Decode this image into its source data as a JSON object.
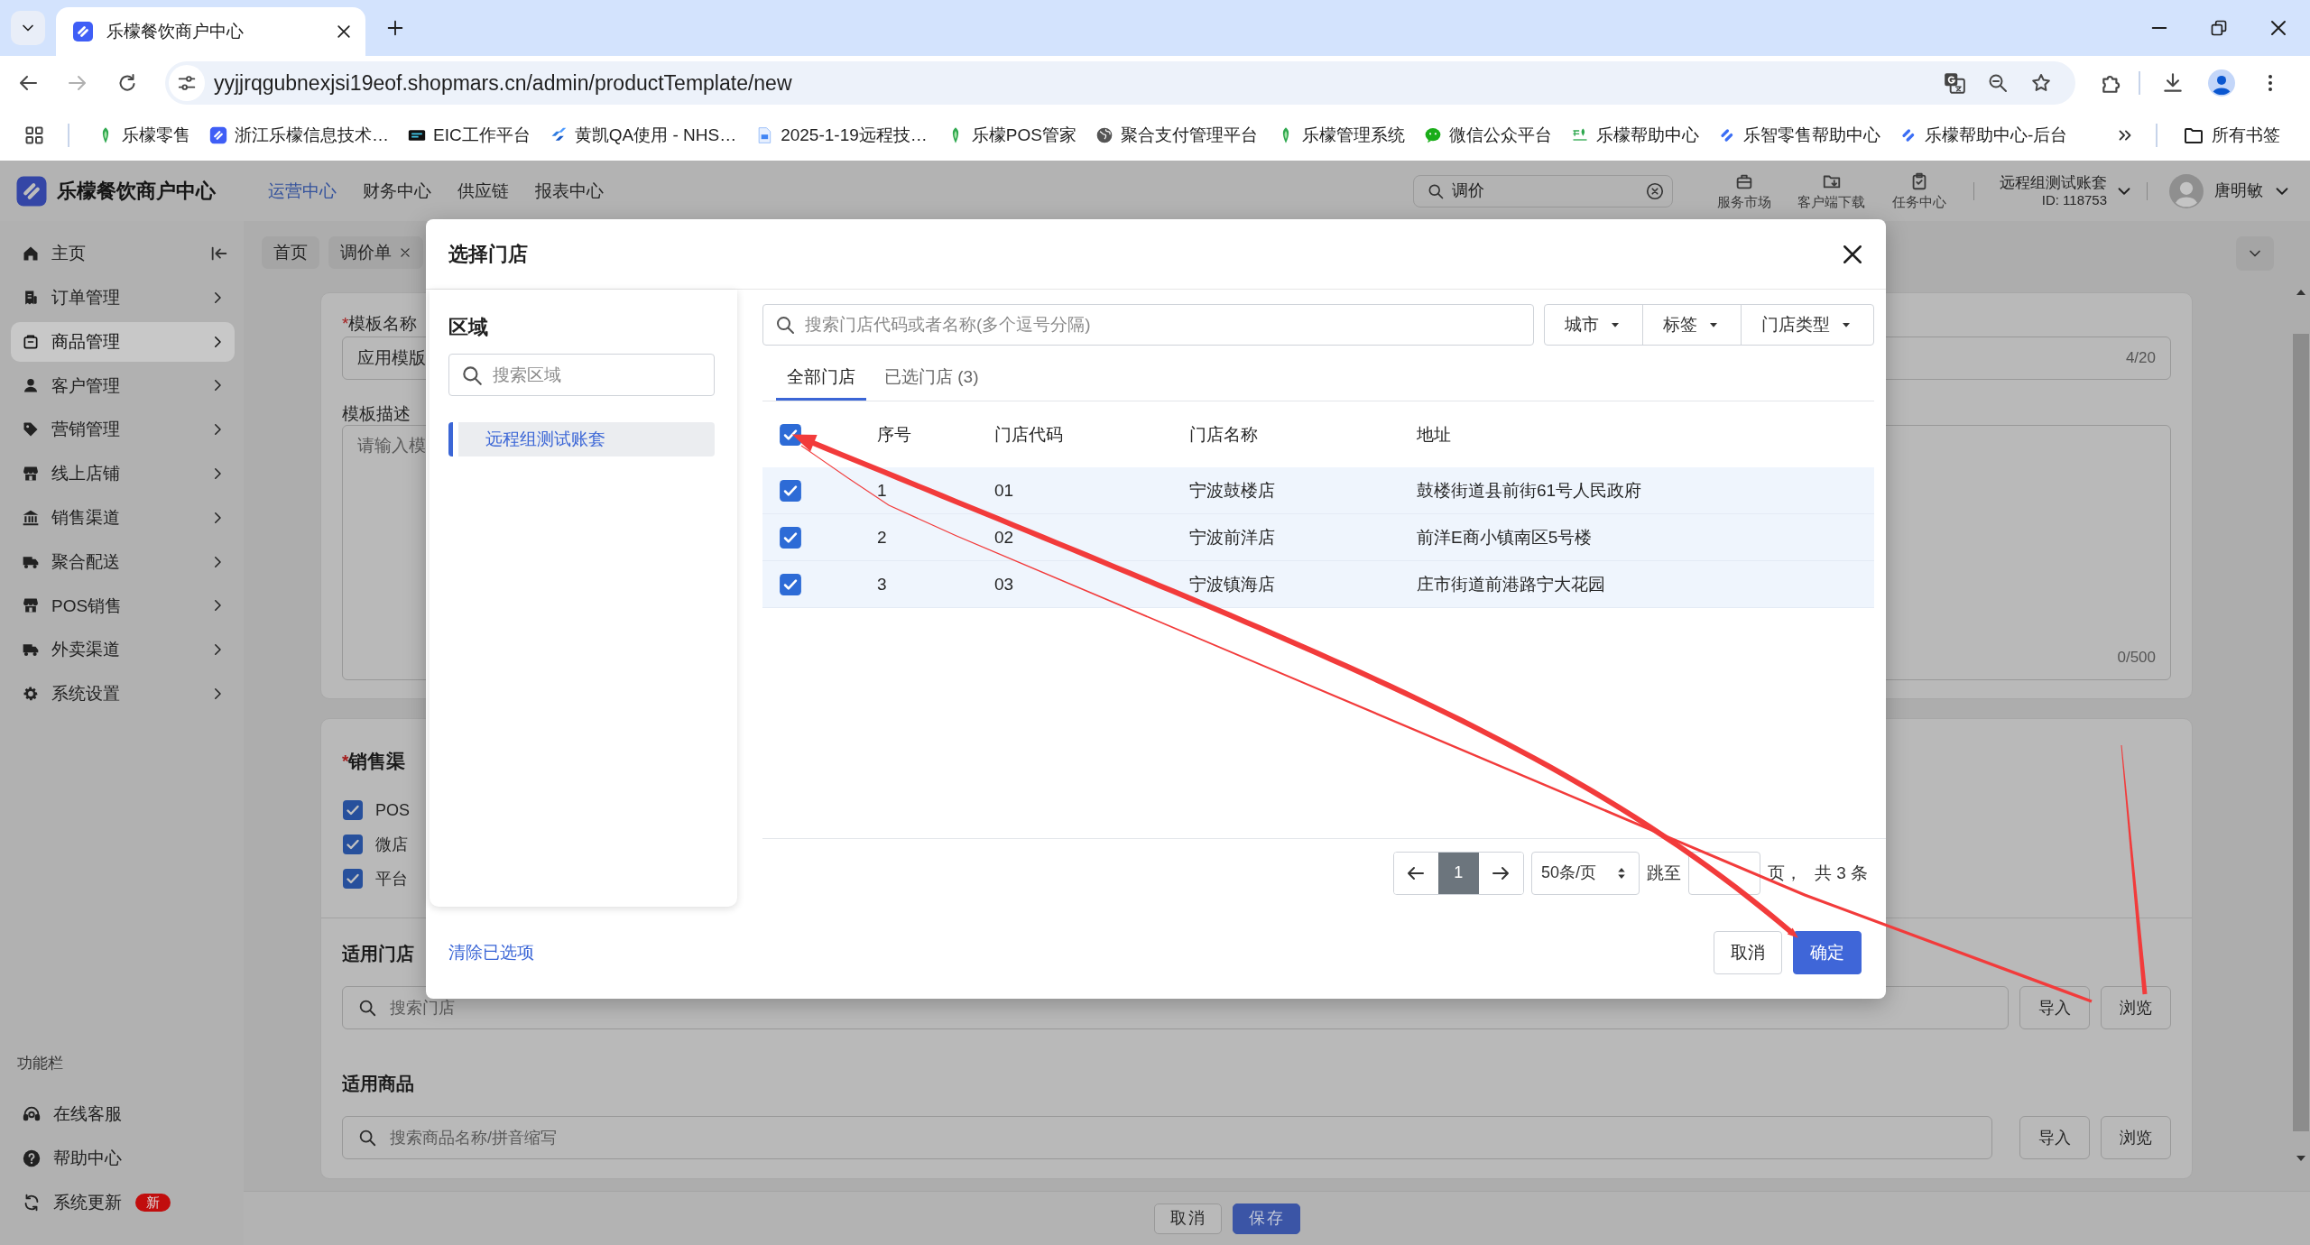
{
  "browser": {
    "tabs": [
      {
        "title": "乐檬餐饮商户中心",
        "selected": true
      }
    ],
    "address": "yyjjrqgubnexjsi19eof.shopmars.cn/admin/productTemplate/new",
    "bookmarks": [
      {
        "label": "乐檬零售",
        "kind": "leaf"
      },
      {
        "label": "浙江乐檬信息技术…",
        "kind": "logo"
      },
      {
        "label": "EIC工作平台",
        "kind": "eic"
      },
      {
        "label": "黄凯QA使用 - NHS…",
        "kind": "jira"
      },
      {
        "label": "2025-1-19远程技…",
        "kind": "doc"
      },
      {
        "label": "乐檬POS管家",
        "kind": "leaf"
      },
      {
        "label": "聚合支付管理平台",
        "kind": "globe"
      },
      {
        "label": "乐檬管理系统",
        "kind": "leaf"
      },
      {
        "label": "微信公众平台",
        "kind": "wechat"
      },
      {
        "label": "乐檬帮助中心",
        "kind": "wordmark"
      },
      {
        "label": "乐智零售帮助中心",
        "kind": "slash"
      },
      {
        "label": "乐檬帮助中心-后台",
        "kind": "slash"
      }
    ],
    "all_bookmarks": "所有书签"
  },
  "app": {
    "header": {
      "brand": "乐檬餐饮商户中心",
      "nav": [
        {
          "label": "运营中心",
          "selected": true
        },
        {
          "label": "财务中心",
          "selected": false
        },
        {
          "label": "供应链",
          "selected": false
        },
        {
          "label": "报表中心",
          "selected": false
        }
      ],
      "search": {
        "value": "调价"
      },
      "tools": [
        {
          "label": "服务市场",
          "kind": "bag"
        },
        {
          "label": "客户端下载",
          "kind": "folder"
        },
        {
          "label": "任务中心",
          "kind": "clipboard"
        }
      ],
      "account": {
        "name": "远程组测试账套",
        "id": "ID: 118753"
      },
      "user": "唐明敏"
    },
    "sidebar": {
      "collapse_button": true,
      "items": [
        {
          "label": "主页",
          "kind": "home",
          "selected": false,
          "has_children": false
        },
        {
          "label": "订单管理",
          "kind": "receipt",
          "selected": false,
          "has_children": true
        },
        {
          "label": "商品管理",
          "kind": "box",
          "selected": true,
          "has_children": true
        },
        {
          "label": "客户管理",
          "kind": "person",
          "selected": false,
          "has_children": true
        },
        {
          "label": "营销管理",
          "kind": "tag",
          "selected": false,
          "has_children": true
        },
        {
          "label": "线上店铺",
          "kind": "shop",
          "selected": false,
          "has_children": true
        },
        {
          "label": "销售渠道",
          "kind": "bank",
          "selected": false,
          "has_children": true
        },
        {
          "label": "聚合配送",
          "kind": "truck",
          "selected": false,
          "has_children": true
        },
        {
          "label": "POS销售",
          "kind": "shop",
          "selected": false,
          "has_children": true
        },
        {
          "label": "外卖渠道",
          "kind": "truck",
          "selected": false,
          "has_children": true
        },
        {
          "label": "系统设置",
          "kind": "gear",
          "selected": false,
          "has_children": true
        }
      ],
      "section_title": "功能栏",
      "tools": [
        {
          "label": "在线客服",
          "kind": "headset"
        },
        {
          "label": "帮助中心",
          "kind": "help"
        },
        {
          "label": "系统更新",
          "kind": "refresh",
          "badge": "新"
        }
      ]
    },
    "page_tabs": [
      {
        "label": "首页",
        "closable": false
      },
      {
        "label": "调价单",
        "closable": true
      }
    ],
    "form": {
      "name": {
        "required_mark": "*",
        "label": "模板名称",
        "value": "应用模版",
        "counter": "4/20"
      },
      "description": {
        "label": "模板描述",
        "placeholder": "请输入模",
        "counter": "0/500"
      }
    },
    "channels": {
      "required_mark": "*",
      "title": "销售渠",
      "options": [
        {
          "label": "POS",
          "checked": true
        },
        {
          "label": "微店",
          "checked": true
        },
        {
          "label": "平台",
          "checked": true
        }
      ]
    },
    "stores": {
      "title": "适用门店",
      "placeholder": "搜索门店",
      "buttons": [
        "导入",
        "浏览"
      ]
    },
    "goods": {
      "title": "适用商品",
      "placeholder": "搜索商品名称/拼音缩写",
      "buttons": [
        "导入",
        "浏览"
      ]
    },
    "actions": [
      {
        "label": "取消",
        "kind": "secondary"
      },
      {
        "label": "保存",
        "kind": "primary"
      }
    ]
  },
  "dialog": {
    "title": "选择门店",
    "region": {
      "title": "区域",
      "placeholder": "搜索区域",
      "items": [
        {
          "label": "远程组测试账套",
          "selected": true
        }
      ]
    },
    "search_placeholder": "搜索门店代码或者名称(多个逗号分隔)",
    "filters": [
      "城市",
      "标签",
      "门店类型"
    ],
    "tabs": [
      {
        "label": "全部门店",
        "selected": true
      },
      {
        "label": "已选门店 (3)",
        "selected": false
      }
    ],
    "table": {
      "all_checked": true,
      "columns": [
        "序号",
        "门店代码",
        "门店名称",
        "地址"
      ],
      "rows": [
        {
          "checked": true,
          "cells": [
            "1",
            "01",
            "宁波鼓楼店",
            "鼓楼街道县前街61号人民政府"
          ]
        },
        {
          "checked": true,
          "cells": [
            "2",
            "02",
            "宁波前洋店",
            "前洋E商小镇南区5号楼"
          ]
        },
        {
          "checked": true,
          "cells": [
            "3",
            "03",
            "宁波镇海店",
            "庄市街道前港路宁大花园"
          ]
        }
      ]
    },
    "pagination": {
      "pages": [
        {
          "label": "1",
          "selected": true
        }
      ],
      "page_size": "50条/页",
      "jump_label": "跳至",
      "page_suffix": "页，",
      "total": "共 3 条"
    },
    "clear_link": "清除已选项",
    "buttons": [
      {
        "label": "取消",
        "kind": "secondary"
      },
      {
        "label": "确定",
        "kind": "primary"
      }
    ]
  },
  "annotations": [
    {
      "kind": "arrow"
    },
    {
      "kind": "line"
    },
    {
      "kind": "line"
    }
  ]
}
